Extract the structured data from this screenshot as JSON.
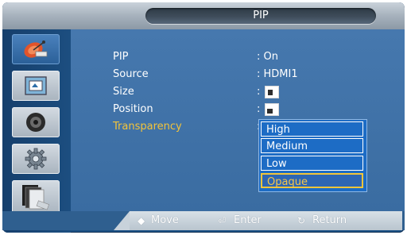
{
  "window": {
    "title": "PIP"
  },
  "sidebar": {
    "items": [
      {
        "icon": "satellite-dish-icon",
        "active": true
      },
      {
        "icon": "picture-icon",
        "active": false
      },
      {
        "icon": "speaker-icon",
        "active": false
      },
      {
        "icon": "gear-icon",
        "active": false
      },
      {
        "icon": "multi-screen-icon",
        "active": false
      }
    ]
  },
  "menu": {
    "rows": [
      {
        "label": "PIP",
        "value": ": On"
      },
      {
        "label": "Source",
        "value": ": HDMI1"
      },
      {
        "label": "Size",
        "value": ":"
      },
      {
        "label": "Position",
        "value": ":"
      },
      {
        "label": "Transparency",
        "value": ":"
      }
    ]
  },
  "dropdown": {
    "options": [
      "High",
      "Medium",
      "Low",
      "Opaque"
    ],
    "selected": "Opaque"
  },
  "footer": {
    "move": "Move",
    "enter": "Enter",
    "return": "Return"
  },
  "colors": {
    "panel_blue": "#3a6ca1",
    "highlight_gold": "#f3c43a",
    "dropdown_blue": "#1d6cc5"
  }
}
